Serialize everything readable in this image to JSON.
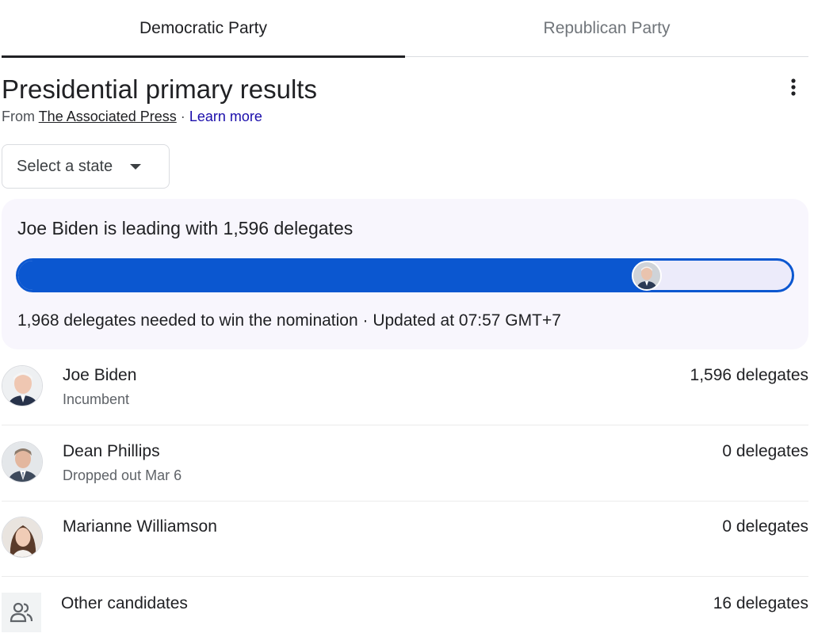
{
  "tabs": [
    {
      "label": "Democratic Party",
      "active": true
    },
    {
      "label": "Republican Party",
      "active": false
    }
  ],
  "header": {
    "title": "Presidential primary results",
    "source_prefix": "From",
    "source_name": "The Associated Press",
    "separator": "·",
    "learn_more": "Learn more",
    "more_icon": "more-vert-icon"
  },
  "state_select": {
    "label": "Select a state",
    "icon": "dropdown-caret-icon"
  },
  "summary": {
    "leading_text": "Joe Biden is leading with 1,596 delegates",
    "progress_fraction": 0.811,
    "footer": "1,968 delegates needed to win the nomination · Updated at 07:57 GMT+7",
    "colors": {
      "bar": "#0b57d0",
      "track": "#ecebfa",
      "card": "#f8f6fd"
    }
  },
  "candidates": [
    {
      "name": "Joe Biden",
      "status": "Incumbent",
      "delegates": "1,596 delegates"
    },
    {
      "name": "Dean Phillips",
      "status": "Dropped out Mar 6",
      "delegates": "0 delegates"
    },
    {
      "name": "Marianne Williamson",
      "status": "",
      "delegates": "0 delegates"
    }
  ],
  "others": {
    "name": "Other candidates",
    "delegates": "16 delegates",
    "icon": "people-icon"
  }
}
